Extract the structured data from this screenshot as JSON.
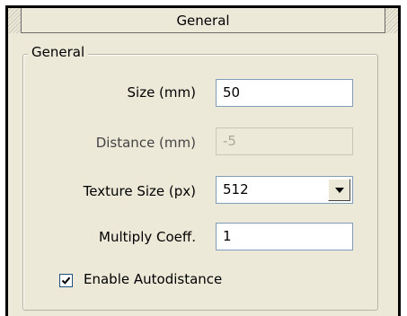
{
  "panel": {
    "tab_title": "General"
  },
  "group": {
    "title": "General",
    "fields": {
      "size": {
        "label": "Size (mm)",
        "value": "50"
      },
      "distance": {
        "label": "Distance (mm)",
        "value": "-5"
      },
      "texture_size": {
        "label": "Texture Size (px)",
        "value": "512"
      },
      "multiply_coeff": {
        "label": "Multiply Coeff.",
        "value": "1"
      }
    },
    "enable_autodistance": {
      "label": "Enable Autodistance",
      "checked": true
    }
  }
}
